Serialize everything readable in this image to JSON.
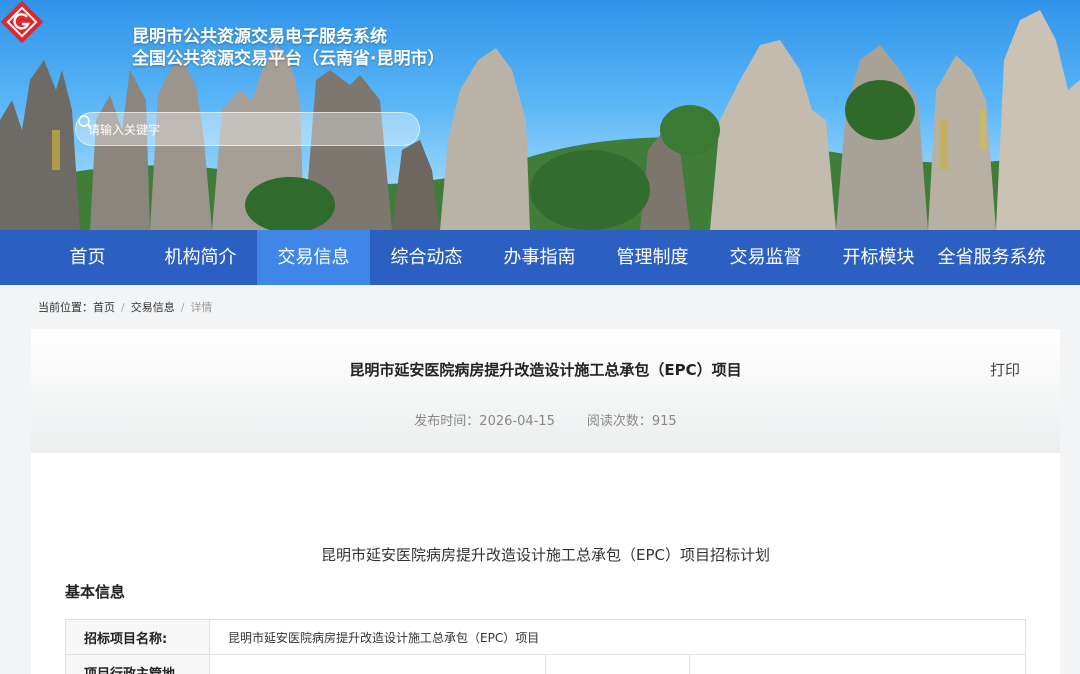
{
  "header": {
    "title_line1": "昆明市公共资源交易电子服务系统",
    "title_line2": "全国公共资源交易平台（云南省·昆明市）",
    "search_placeholder": "请输入关键字"
  },
  "nav": {
    "items": [
      {
        "label": "首页",
        "active": false
      },
      {
        "label": "机构简介",
        "active": false
      },
      {
        "label": "交易信息",
        "active": true
      },
      {
        "label": "综合动态",
        "active": false
      },
      {
        "label": "办事指南",
        "active": false
      },
      {
        "label": "管理制度",
        "active": false
      },
      {
        "label": "交易监督",
        "active": false
      },
      {
        "label": "开标模块",
        "active": false
      },
      {
        "label": "全省服务系统",
        "active": false
      }
    ]
  },
  "breadcrumb": {
    "prefix": "当前位置：",
    "home": "首页",
    "section": "交易信息",
    "current": "详情"
  },
  "article": {
    "title": "昆明市延安医院病房提升改造设计施工总承包（EPC）项目",
    "print_label": "打印",
    "publish_label": "发布时间：2026-04-15",
    "views_label": "阅读次数：915",
    "doc_title": "昆明市延安医院病房提升改造设计施工总承包（EPC）项目招标计划",
    "section_title": "基本信息",
    "rows": [
      {
        "label": "招标项目名称:",
        "value": "昆明市延安医院病房提升改造设计施工总承包（EPC）项目"
      },
      {
        "label": "项目行政主管地",
        "value": ""
      }
    ]
  },
  "colors": {
    "nav_bg": "#2b5fc2",
    "nav_active": "#3f86e8",
    "logo_red": "#e0262b"
  }
}
